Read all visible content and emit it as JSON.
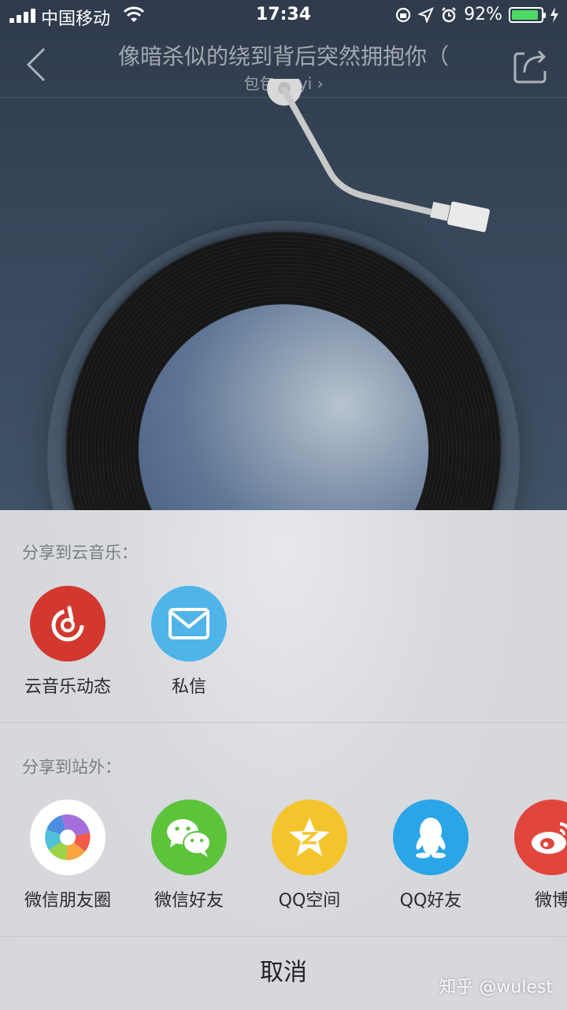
{
  "status_bar": {
    "carrier": "中国移动",
    "time": "17:34",
    "battery": "92%",
    "battery_level": 0.92
  },
  "nav": {
    "title": "像暗杀似的绕到背后突然拥抱你（",
    "artist": "包包.suyi",
    "artist_chevron": "›"
  },
  "share_sheet": {
    "internal_title": "分享到云音乐：",
    "internal_items": [
      {
        "label": "云音乐动态",
        "icon": "netease-music-icon",
        "color": "#d3382f"
      },
      {
        "label": "私信",
        "icon": "envelope-icon",
        "color": "#4fb4e8"
      }
    ],
    "external_title": "分享到站外：",
    "external_items": [
      {
        "label": "微信朋友圈",
        "icon": "wechat-moments-icon",
        "color": "#ffffff"
      },
      {
        "label": "微信好友",
        "icon": "wechat-icon",
        "color": "#5cc43b"
      },
      {
        "label": "QQ空间",
        "icon": "qzone-icon",
        "color": "#f5c42c"
      },
      {
        "label": "QQ好友",
        "icon": "qq-icon",
        "color": "#29a5e8"
      },
      {
        "label": "微博",
        "icon": "weibo-icon",
        "color": "#e1463d"
      }
    ],
    "cancel_label": "取消"
  },
  "watermark": "知乎 @wulest"
}
